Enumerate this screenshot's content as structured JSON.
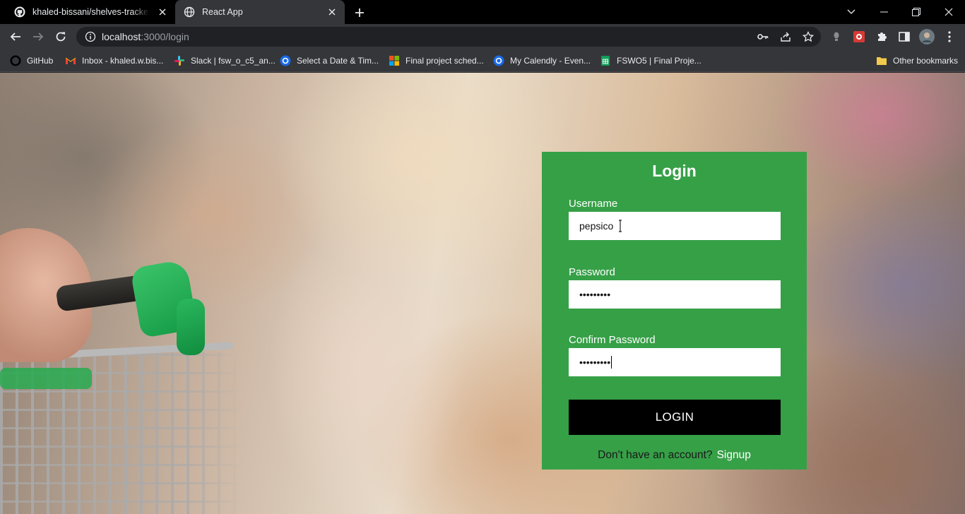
{
  "browser": {
    "tabs": [
      {
        "title": "khaled-bissani/shelves-tracker at",
        "active": false
      },
      {
        "title": "React App",
        "active": true
      }
    ],
    "url": {
      "host": "localhost",
      "path": ":3000/login"
    },
    "bookmarks": [
      {
        "label": "GitHub",
        "icon": "github-icon"
      },
      {
        "label": "Inbox - khaled.w.bis...",
        "icon": "gmail-icon"
      },
      {
        "label": "Slack | fsw_o_c5_an...",
        "icon": "slack-icon"
      },
      {
        "label": "Select a Date & Tim...",
        "icon": "calendly-icon"
      },
      {
        "label": "Final project sched...",
        "icon": "microsoft-icon"
      },
      {
        "label": "My Calendly - Even...",
        "icon": "calendly-icon"
      },
      {
        "label": "FSWO5 | Final Proje...",
        "icon": "sheets-icon"
      }
    ],
    "other_bookmarks": "Other bookmarks"
  },
  "login": {
    "title": "Login",
    "username_label": "Username",
    "username_value": "pepsico",
    "password_label": "Password",
    "password_value": "•••••••••",
    "confirm_label": "Confirm Password",
    "confirm_value": "•••••••••",
    "button_label": "LOGIN",
    "signup_prompt": "Don't have an account?",
    "signup_link": "Signup"
  },
  "colors": {
    "card": "#36a047",
    "button": "#000000",
    "toolbar": "#35363a"
  }
}
